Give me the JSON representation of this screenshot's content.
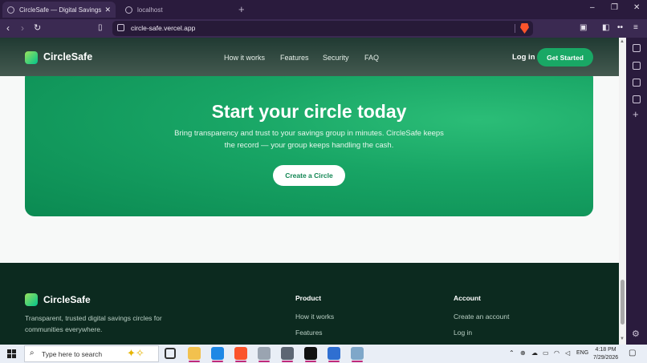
{
  "browser": {
    "tabs": [
      {
        "title": "CircleSafe — Digital Savings Circ",
        "active": true
      },
      {
        "title": "localhost",
        "active": false
      }
    ],
    "url": "circle-safe.vercel.app",
    "window_controls": {
      "minimize": "–",
      "restore": "❐",
      "close": "✕"
    },
    "new_tab": "+"
  },
  "site": {
    "brand": "CircleSafe",
    "nav": [
      "How it works",
      "Features",
      "Security",
      "FAQ"
    ],
    "login": "Log in",
    "get_started": "Get Started",
    "cta": {
      "title": "Start your circle today",
      "body": "Bring transparency and trust to your savings group in minutes. CircleSafe keeps the record — your group keeps handling the cash.",
      "button": "Create a Circle"
    },
    "footer": {
      "brand": "CircleSafe",
      "description": "Transparent, trusted digital savings circles for communities everywhere.",
      "columns": [
        {
          "heading": "Product",
          "links": [
            "How it works",
            "Features"
          ]
        },
        {
          "heading": "Account",
          "links": [
            "Create an account",
            "Log in"
          ]
        }
      ]
    }
  },
  "taskbar": {
    "search_placeholder": "Type here to search",
    "language": "ENG",
    "time": "4:18 PM",
    "date": "7/29/2026"
  },
  "colors": {
    "brand_green": "#19a865",
    "header_dark": "#203a32",
    "footer_dark": "#0c2a1f",
    "browser_purple": "#3b2a52"
  }
}
